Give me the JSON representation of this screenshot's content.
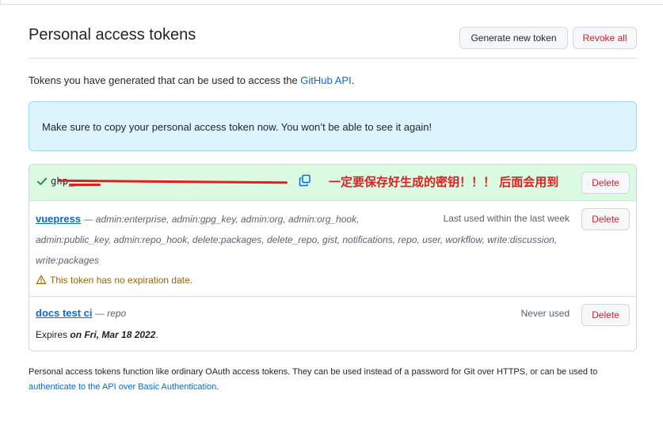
{
  "page": {
    "title": "Personal access tokens",
    "generate_label": "Generate new token",
    "revoke_all_label": "Revoke all"
  },
  "intro": {
    "text": "Tokens you have generated that can be used to access the ",
    "link": "GitHub API",
    "suffix": "."
  },
  "flash": {
    "message": "Make sure to copy your personal access token now. You won’t be able to see it again!"
  },
  "new_token": {
    "value": "ghp_",
    "annotation": "一定要保存好生成的密钥！！！ 后面会用到",
    "delete_label": "Delete"
  },
  "tokens": [
    {
      "name": "vuepress",
      "scopes_line1": "— admin:enterprise, admin:gpg_key, admin:org, admin:org_hook,",
      "scopes_line2": "admin:public_key, admin:repo_hook, delete:packages, delete_repo, gist, notifications, repo, user, workflow, write:discussion,",
      "scopes_line3": "write:packages",
      "last_used": "Last used within the last week",
      "warning": "This token has no expiration date.",
      "delete_label": "Delete"
    },
    {
      "name": "docs test ci",
      "scopes_line1": "— repo",
      "last_used": "Never used",
      "expires_prefix": "Expires ",
      "expires_date": "on Fri, Mar 18 2022",
      "expires_suffix": ".",
      "delete_label": "Delete"
    }
  ],
  "footer": {
    "text": "Personal access tokens function like ordinary OAuth access tokens. They can be used instead of a password for Git over HTTPS, or can be used to",
    "link": "authenticate to the API over Basic Authentication",
    "suffix": "."
  },
  "colors": {
    "accent": "#0969da",
    "danger": "#cf222e",
    "flash_bg": "#ddf4ff",
    "success_bg": "#dafbe1",
    "annotation": "#e02020",
    "warning": "#9a6700"
  },
  "icons": {
    "check": "check-icon",
    "copy": "copy-icon",
    "warning": "alert-icon"
  }
}
